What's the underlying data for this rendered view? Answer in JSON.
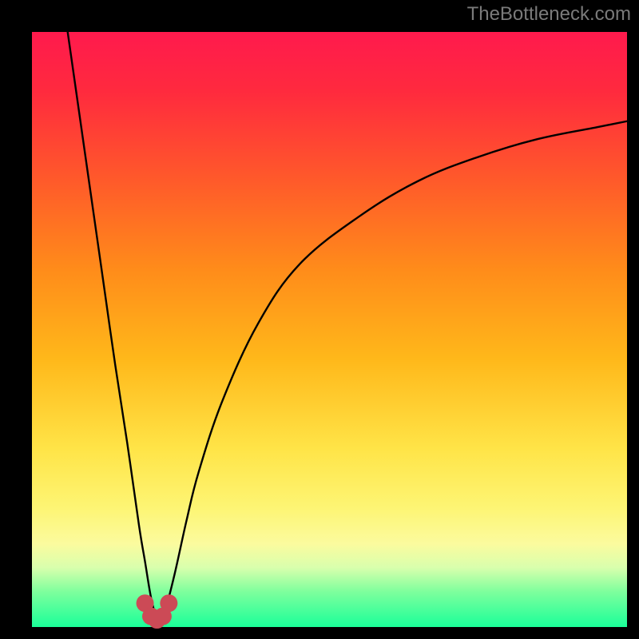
{
  "watermark": "TheBottleneck.com",
  "colors": {
    "frame": "#000000",
    "curve": "#000000",
    "marker": "#cc4a56",
    "gradient_top": "#ff1a4d",
    "gradient_bottom": "#1aff99"
  },
  "chart_data": {
    "type": "line",
    "title": "",
    "xlabel": "",
    "ylabel": "",
    "xlim": [
      0,
      100
    ],
    "ylim": [
      0,
      100
    ],
    "note": "Two-branch bottleneck curve. Left branch descends steeply from top-left to a minimum near x≈21; right branch rises convexly toward the top-right. Values estimated from pixel positions.",
    "series": [
      {
        "name": "left-branch",
        "x": [
          6,
          8,
          10,
          12,
          14,
          16,
          18,
          19,
          20,
          21
        ],
        "y": [
          100,
          86,
          72,
          58,
          44,
          31,
          17,
          11,
          5,
          1
        ]
      },
      {
        "name": "right-branch",
        "x": [
          22,
          24,
          26,
          28,
          32,
          38,
          45,
          55,
          65,
          75,
          85,
          95,
          100
        ],
        "y": [
          1,
          9,
          18,
          26,
          38,
          51,
          61,
          69,
          75,
          79,
          82,
          84,
          85
        ]
      }
    ],
    "markers": {
      "name": "highlight-cluster",
      "points": [
        {
          "x": 19.0,
          "y": 4.0
        },
        {
          "x": 20.0,
          "y": 1.8
        },
        {
          "x": 21.0,
          "y": 1.2
        },
        {
          "x": 22.0,
          "y": 1.8
        },
        {
          "x": 23.0,
          "y": 4.0
        }
      ]
    }
  }
}
